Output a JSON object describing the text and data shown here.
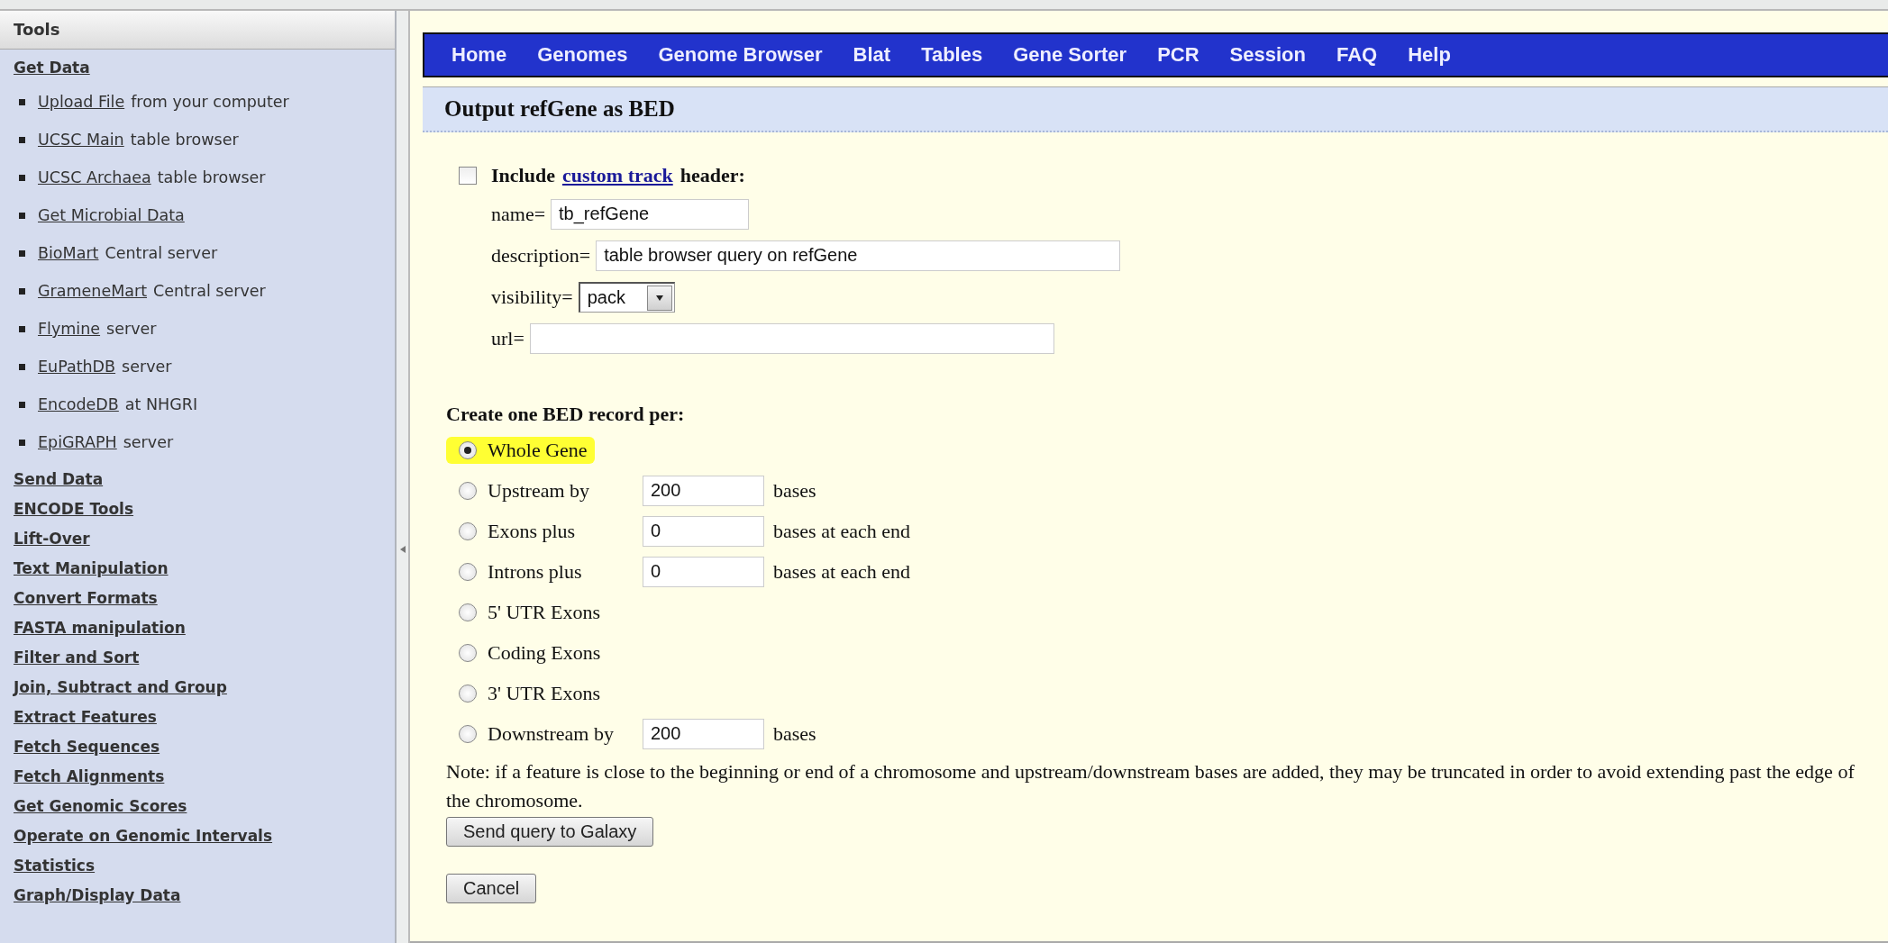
{
  "sidebar": {
    "title": "Tools",
    "sections": [
      {
        "label": "Get Data",
        "items": [
          {
            "link": "Upload File",
            "rest": "from your computer"
          },
          {
            "link": "UCSC Main",
            "rest": "table browser"
          },
          {
            "link": "UCSC Archaea",
            "rest": "table browser"
          },
          {
            "link": "Get Microbial Data"
          },
          {
            "link": "BioMart",
            "rest": "Central server"
          },
          {
            "link": "GrameneMart",
            "rest": "Central server"
          },
          {
            "link": "Flymine",
            "rest": "server"
          },
          {
            "link": "EuPathDB",
            "rest": "server"
          },
          {
            "link": "EncodeDB",
            "rest": "at NHGRI"
          },
          {
            "link": "EpiGRAPH",
            "rest": "server"
          }
        ]
      },
      {
        "label": "Send Data"
      },
      {
        "label": "ENCODE Tools"
      },
      {
        "label": "Lift-Over"
      },
      {
        "label": "Text Manipulation"
      },
      {
        "label": "Convert Formats"
      },
      {
        "label": "FASTA manipulation"
      },
      {
        "label": "Filter and Sort"
      },
      {
        "label": "Join, Subtract and Group"
      },
      {
        "label": "Extract Features"
      },
      {
        "label": "Fetch Sequences"
      },
      {
        "label": "Fetch Alignments"
      },
      {
        "label": "Get Genomic Scores"
      },
      {
        "label": "Operate on Genomic Intervals"
      },
      {
        "label": "Statistics"
      },
      {
        "label": "Graph/Display Data"
      }
    ]
  },
  "nav": [
    "Home",
    "Genomes",
    "Genome Browser",
    "Blat",
    "Tables",
    "Gene Sorter",
    "PCR",
    "Session",
    "FAQ",
    "Help"
  ],
  "heading": "Output refGene as BED",
  "header_option": {
    "checked": false,
    "before": "Include",
    "link": "custom track",
    "after": "header:"
  },
  "fields": [
    {
      "kind": "short_text",
      "label": "name=",
      "value": "tb_refGene"
    },
    {
      "kind": "long_text",
      "label": "description=",
      "value": "table browser query on refGene"
    },
    {
      "kind": "select",
      "label": "visibility=",
      "value": "pack"
    },
    {
      "kind": "long_text",
      "label": "url="
    }
  ],
  "record_title": "Create one BED record per:",
  "options": [
    {
      "label": "Whole Gene",
      "selected": true,
      "highlighted": true
    },
    {
      "label": "Upstream by",
      "selected": false,
      "highlighted": false,
      "value": "200",
      "suffix": "bases"
    },
    {
      "label": "Exons plus",
      "selected": false,
      "highlighted": false,
      "value": "0",
      "suffix": "bases at each end"
    },
    {
      "label": "Introns plus",
      "selected": false,
      "highlighted": false,
      "value": "0",
      "suffix": "bases at each end"
    },
    {
      "label": "5' UTR Exons",
      "selected": false,
      "highlighted": false
    },
    {
      "label": "Coding Exons",
      "selected": false,
      "highlighted": false
    },
    {
      "label": "3' UTR Exons",
      "selected": false,
      "highlighted": false
    },
    {
      "label": "Downstream by",
      "selected": false,
      "highlighted": false,
      "value": "200",
      "suffix": "bases"
    }
  ],
  "note": "Note: if a feature is close to the beginning or end of a chromosome and upstream/downstream bases are added, they may be truncated in order to avoid extending past the edge of the chromosome.",
  "buttons": [
    "Send query to Galaxy",
    "Cancel"
  ]
}
